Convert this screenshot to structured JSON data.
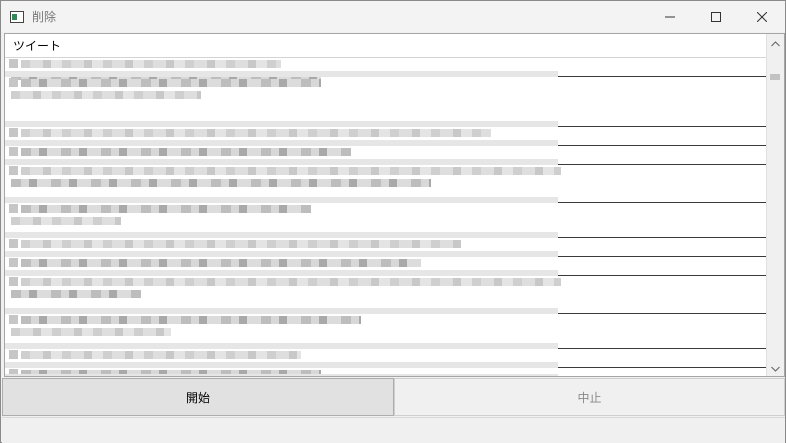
{
  "window": {
    "title": "削除",
    "icon": "window-app-icon"
  },
  "window_controls": {
    "minimize_icon": "minimize-icon",
    "maximize_icon": "maximize-icon",
    "close_icon": "close-icon"
  },
  "table": {
    "columns": [
      "ツイート"
    ],
    "rows_note_redacted": true
  },
  "buttons": {
    "start_label": "開始",
    "stop_label": "中止"
  }
}
